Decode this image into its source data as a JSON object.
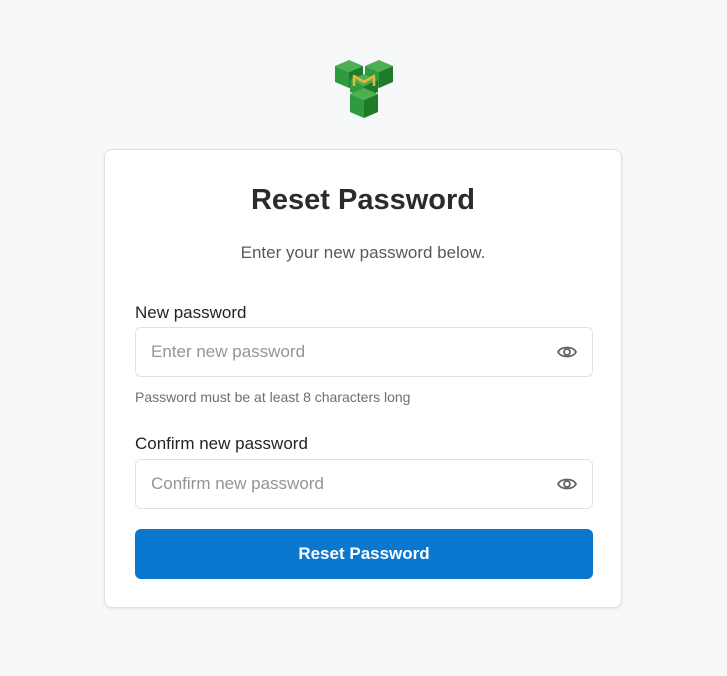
{
  "header": {
    "logo_icon": "cube-logo-icon",
    "logo_colors": {
      "green_light": "#4caf50",
      "green_mid": "#2e9c3e",
      "green_dark": "#1f7a2c",
      "accent": "#e0b83a"
    }
  },
  "card": {
    "title": "Reset Password",
    "subtitle": "Enter your new password below.",
    "new_password": {
      "label": "New password",
      "placeholder": "Enter new password",
      "value": "",
      "toggle_icon": "eye-icon",
      "hint": "Password must be at least 8 characters long"
    },
    "confirm_password": {
      "label": "Confirm new password",
      "placeholder": "Confirm new password",
      "value": "",
      "toggle_icon": "eye-icon"
    },
    "submit_label": "Reset Password"
  },
  "colors": {
    "background": "#f7f8fa",
    "primary": "#0b78d0",
    "border": "#dee2e6"
  }
}
